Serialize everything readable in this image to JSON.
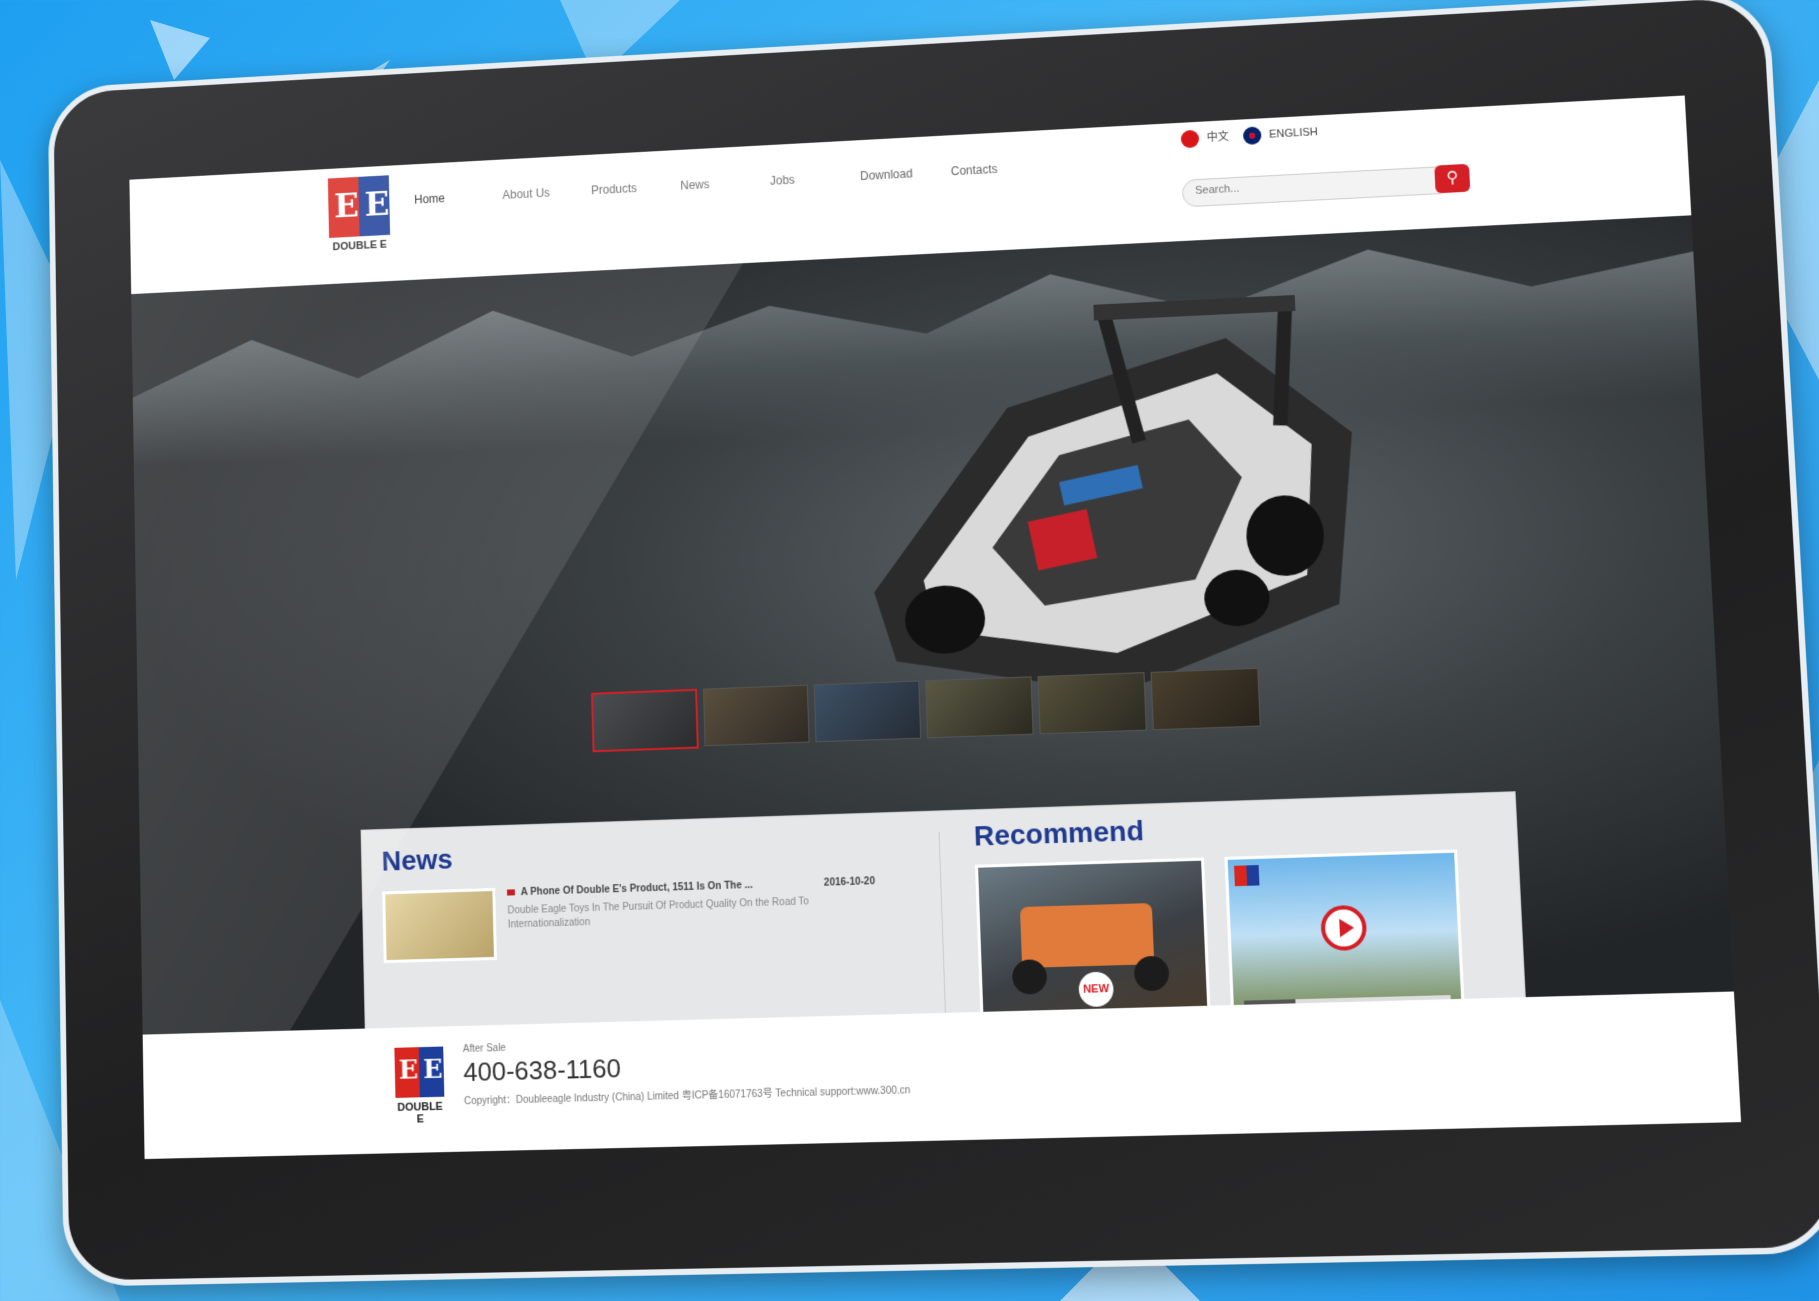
{
  "header": {
    "logo_text": "DOUBLE E",
    "logo_glyph": "EE",
    "nav": [
      "Home",
      "About Us",
      "Products",
      "News",
      "Jobs",
      "Download",
      "Contacts"
    ],
    "lang_cn": "中文",
    "lang_en": "ENGLISH",
    "search_placeholder": "Search...",
    "search_icon": "search-icon"
  },
  "news": {
    "title": "News",
    "item_title": "A Phone Of Double E's Product, 1511 Is On The ...",
    "item_date": "2016-10-20",
    "item_desc": "Double Eagle Toys In The Pursuit Of Product Quality On the Road To Internationalization"
  },
  "recommend": {
    "title": "Recommend",
    "new_badge": "NEW"
  },
  "footer": {
    "aftersale_label": "After Sale",
    "hotline": "400-638-1160",
    "copyright": "Copyright：Doubleeagle Industry (China) Limited  粤ICP备16071763号  Technical support:www.300.cn",
    "logo_text": "DOUBLE E"
  },
  "colors": {
    "brand_red": "#d41f26",
    "brand_blue": "#1f3a8f",
    "background_blue": "#1e9ff0"
  }
}
